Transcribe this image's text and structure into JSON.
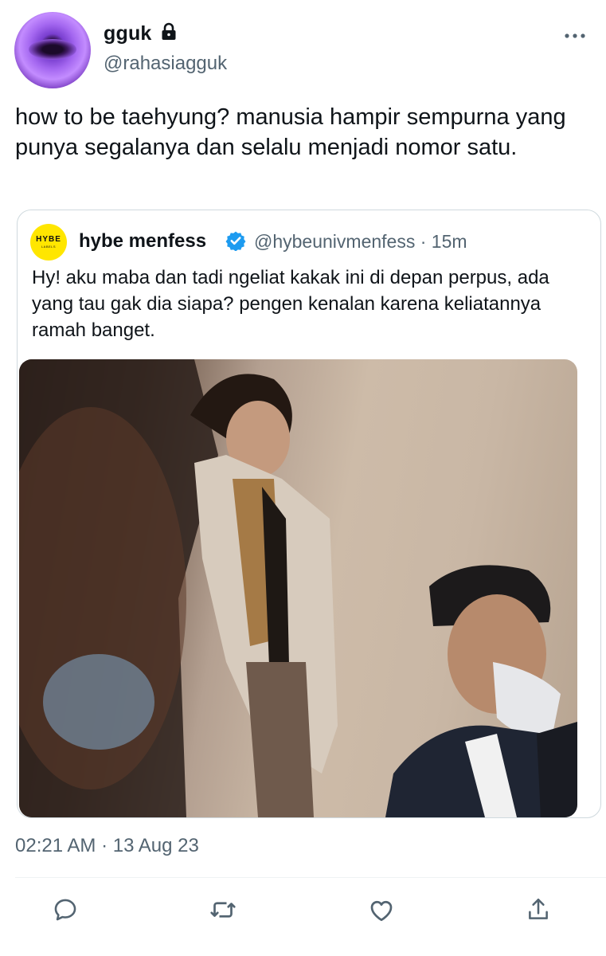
{
  "tweet": {
    "author_name": "gguk",
    "author_handle": "@rahasiagguk",
    "text": "how to be taehyung? manusia hampir sempurna yang punya segalanya dan selalu menjadi nomor satu.",
    "timestamp": "02:21 AM · 13 Aug 23",
    "icons": {
      "lock": "lock-icon",
      "more": "more-icon"
    }
  },
  "quoted_tweet": {
    "avatar_logo": "HYBE",
    "avatar_logo_sub": "LABELS",
    "author_name": "hybe menfess",
    "author_handle": "@hybeunivmenfess",
    "time_ago": "15m",
    "separator": "·",
    "text": "Hy! aku maba dan tadi ngeliat kakak ini di depan perpus, ada yang tau gak dia siapa? pengen kenalan karena keliatannya ramah banget.",
    "verified_color": "#1d9bf0"
  },
  "actions": [
    {
      "icon": "reply-icon"
    },
    {
      "icon": "retweet-icon"
    },
    {
      "icon": "like-icon"
    },
    {
      "icon": "share-icon"
    }
  ],
  "colors": {
    "text": "#0f1419",
    "secondary": "#536471",
    "border": "#cfd9de",
    "avatar_yellow": "#ffe600"
  }
}
